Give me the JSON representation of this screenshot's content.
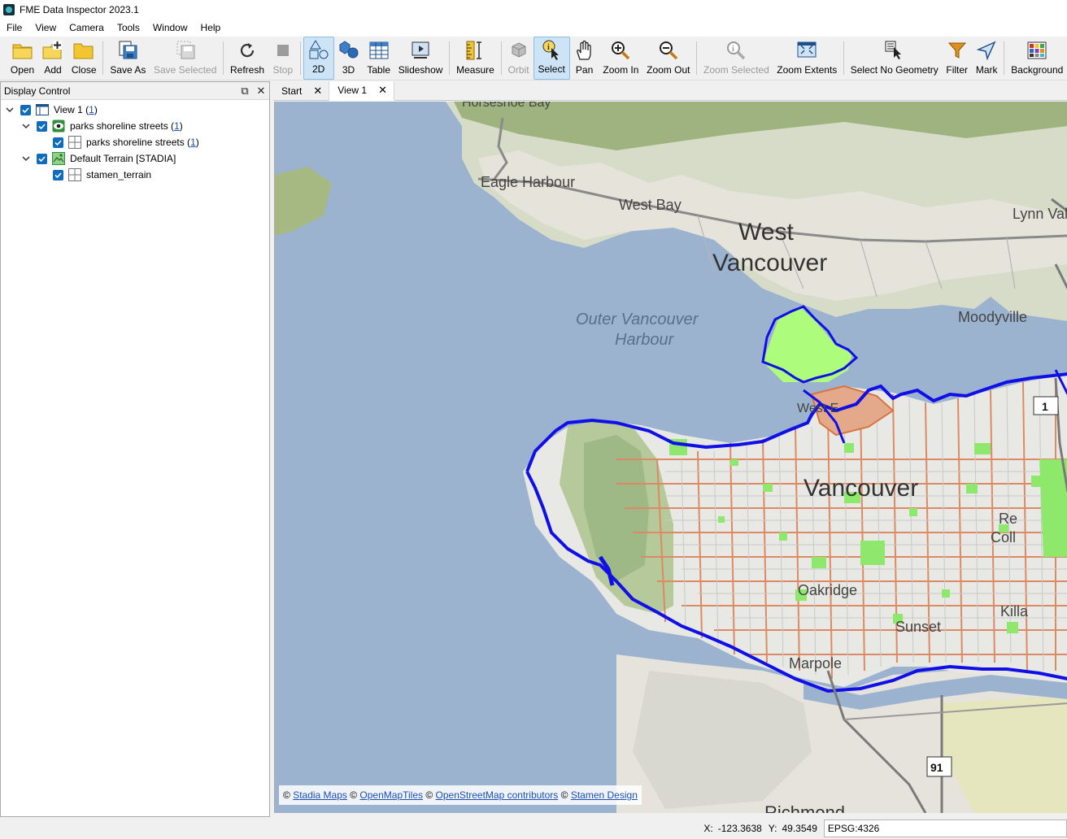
{
  "window": {
    "title": "FME Data Inspector 2023.1"
  },
  "menu": [
    "File",
    "View",
    "Camera",
    "Tools",
    "Window",
    "Help"
  ],
  "toolbar": {
    "open": "Open",
    "add": "Add",
    "close": "Close",
    "save_as": "Save As",
    "save_selected": "Save Selected",
    "refresh": "Refresh",
    "stop": "Stop",
    "view2d": "2D",
    "view3d": "3D",
    "table": "Table",
    "slideshow": "Slideshow",
    "measure": "Measure",
    "orbit": "Orbit",
    "select": "Select",
    "pan": "Pan",
    "zoom_in": "Zoom In",
    "zoom_out": "Zoom Out",
    "zoom_selected": "Zoom Selected",
    "zoom_extents": "Zoom Extents",
    "select_no_geometry": "Select No Geometry",
    "filter": "Filter",
    "mark": "Mark",
    "background": "Background"
  },
  "display_control": {
    "title": "Display Control",
    "tree": [
      {
        "label": "View 1 (",
        "count": "1",
        "close": ")"
      },
      {
        "label": "parks shoreline streets (",
        "count": "1",
        "close": ")"
      },
      {
        "label": "parks shoreline streets (",
        "count": "1",
        "close": ")"
      },
      {
        "label": "Default Terrain [STADIA]"
      },
      {
        "label": "stamen_terrain"
      }
    ]
  },
  "tabs": [
    {
      "label": "Start"
    },
    {
      "label": "View 1"
    }
  ],
  "map": {
    "labels": {
      "horseshoe": "Horseshoe Bay",
      "eagle": "Eagle Harbour",
      "westbay": "West Bay",
      "west": "West",
      "vancouver_w": "Vancouver",
      "lynn": "Lynn Vall",
      "moody": "Moodyville",
      "harbour1": "Outer Vancouver",
      "harbour2": "Harbour",
      "westend": "West E",
      "vancouver": "Vancouver",
      "oakridge": "Oakridge",
      "sunset": "Sunset",
      "marpole": "Marpole",
      "rcoll1": "Re",
      "rcoll2": "Coll",
      "killa": "Killa",
      "richmond": "Richmond",
      "hwy1": "1",
      "hwy91": "91"
    }
  },
  "attribution": {
    "c1": "©",
    "stadia": "Stadia Maps",
    "c2": "©",
    "openmaptiles": "OpenMapTiles",
    "c3": "©",
    "osm": "OpenStreetMap contributors",
    "c4": "©",
    "stamen": "Stamen Design"
  },
  "status": {
    "x_label": "X:",
    "x_value": "-123.3638",
    "y_label": "Y:",
    "y_value": "49.3549",
    "crs": "EPSG:4326"
  }
}
